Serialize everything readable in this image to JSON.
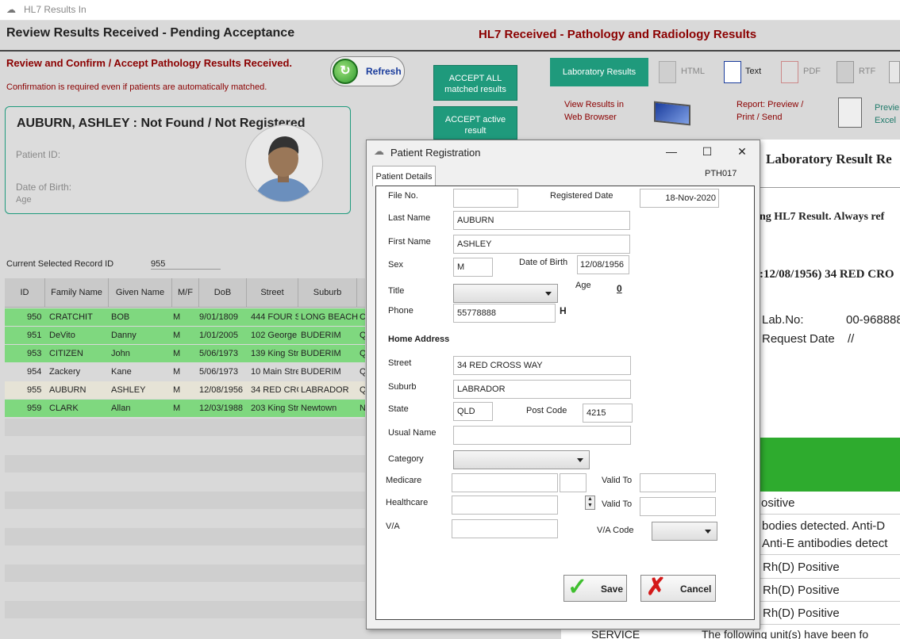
{
  "window": {
    "title": "HL7 Results In"
  },
  "header": {
    "left_title": "Review Results Received - Pending Acceptance",
    "right_title": "HL7 Received - Pathology and Radiology Results",
    "subtitle": "Review and Confirm / Accept Pathology Results Received.",
    "note": "Confirmation is required even if patients are automatically matched.",
    "refresh_label": "Refresh",
    "accept_all_label": "ACCEPT ALL matched results",
    "accept_active_label": "ACCEPT active result"
  },
  "patient_card": {
    "name_status": "AUBURN, ASHLEY : Not Found / Not Registered",
    "patient_id_label": "Patient ID:",
    "dob_label": "Date of Birth:",
    "age_label": "Age"
  },
  "current_record": {
    "label": "Current Selected Record ID",
    "value": "955"
  },
  "grid": {
    "columns": [
      "ID",
      "Family Name",
      "Given Name",
      "M/F",
      "DoB",
      "Street",
      "Suburb"
    ],
    "rows": [
      {
        "id": "950",
        "family": "CRATCHIT",
        "given": "BOB",
        "sex": "M",
        "dob": "9/01/1809",
        "street": "444 FOUR S",
        "suburb": "LONG BEACH",
        "st": "CA",
        "color": "green"
      },
      {
        "id": "951",
        "family": "DeVito",
        "given": "Danny",
        "sex": "M",
        "dob": "1/01/2005",
        "street": "102 George",
        "suburb": "BUDERIM",
        "st": "Q",
        "color": "green"
      },
      {
        "id": "953",
        "family": "CITIZEN",
        "given": "John",
        "sex": "M",
        "dob": "5/06/1973",
        "street": "139 King Str",
        "suburb": "BUDERIM",
        "st": "Q",
        "color": "green"
      },
      {
        "id": "954",
        "family": "Zackery",
        "given": "Kane",
        "sex": "M",
        "dob": "5/06/1973",
        "street": "10 Main Stre",
        "suburb": "BUDERIM",
        "st": "Q",
        "color": "grey"
      },
      {
        "id": "955",
        "family": "AUBURN",
        "given": "ASHLEY",
        "sex": "M",
        "dob": "12/08/1956",
        "street": "34 RED CRC",
        "suburb": "LABRADOR",
        "st": "Q",
        "color": "selected"
      },
      {
        "id": "959",
        "family": "CLARK",
        "given": "Allan",
        "sex": "M",
        "dob": "12/03/1988",
        "street": "203 King Str",
        "suburb": "Newtown",
        "st": "N",
        "color": "green"
      }
    ]
  },
  "right_panel": {
    "lab_results_label": "Laboratory Results",
    "html_label": "HTML",
    "text_label": "Text",
    "pdf_label": "PDF",
    "rtf_label": "RTF",
    "view_browser": "View Results in Web Browser",
    "report_label": "Report:  Preview / Print / Send",
    "preview_excel": "Previe Excel",
    "doc_title": "Laboratory Result Re",
    "doc_line1": "ng HL7 Result. Always ref",
    "doc_line2": ":12/08/1956) 34 RED CRO",
    "lab_no_label": "Lab.No:",
    "lab_no_value": "00-968888",
    "request_date_label": "Request Date",
    "request_date_value": "//",
    "result_rows": [
      "ositive",
      "bodies detected. Anti-D",
      "Anti-E antibodies detect",
      "Rh(D) Positive",
      "Rh(D) Positive",
      "Rh(D) Positive"
    ],
    "service_label": "SERVICE",
    "service_text": "The following unit(s) have been fo"
  },
  "dialog": {
    "title": "Patient Registration",
    "tab": "Patient Details",
    "code": "PTH017",
    "file_no_label": "File No.",
    "file_no": "",
    "registered_date_label": "Registered Date",
    "registered_date": "18-Nov-2020",
    "last_name_label": "Last Name",
    "last_name": "AUBURN",
    "first_name_label": "First Name",
    "first_name": "ASHLEY",
    "sex_label": "Sex",
    "sex": "M",
    "dob_label": "Date of Birth",
    "dob": "12/08/1956",
    "title_label": "Title",
    "age_label": "Age",
    "age": "0",
    "phone_label": "Phone",
    "phone": "55778888",
    "phone_type": "H",
    "home_address_label": "Home Address",
    "street_label": "Street",
    "street": "34 RED CROSS WAY",
    "suburb_label": "Suburb",
    "suburb": "LABRADOR",
    "state_label": "State",
    "state": "QLD",
    "postcode_label": "Post Code",
    "postcode": "4215",
    "usual_name_label": "Usual Name",
    "category_label": "Category",
    "medicare_label": "Medicare",
    "valid_to_label": "Valid To",
    "healthcare_label": "Healthcare",
    "va_label": "V/A",
    "va_code_label": "V/A Code",
    "save_label": "Save",
    "cancel_label": "Cancel"
  }
}
